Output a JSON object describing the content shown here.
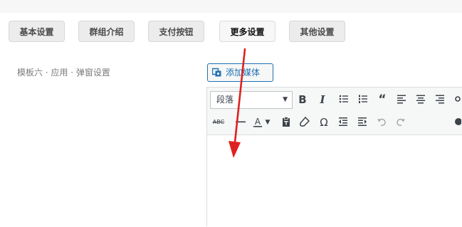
{
  "tabs": [
    {
      "label": "基本设置"
    },
    {
      "label": "群组介绍"
    },
    {
      "label": "支付按钮"
    },
    {
      "label": "更多设置",
      "active": true
    },
    {
      "label": "其他设置"
    }
  ],
  "setting": {
    "label": "模板六 · 应用 · 弹窗设置"
  },
  "editor": {
    "media_button": "添加媒体",
    "format_select": "段落"
  },
  "colors": {
    "accent": "#2271b1",
    "annotation_arrow": "#e02020"
  }
}
